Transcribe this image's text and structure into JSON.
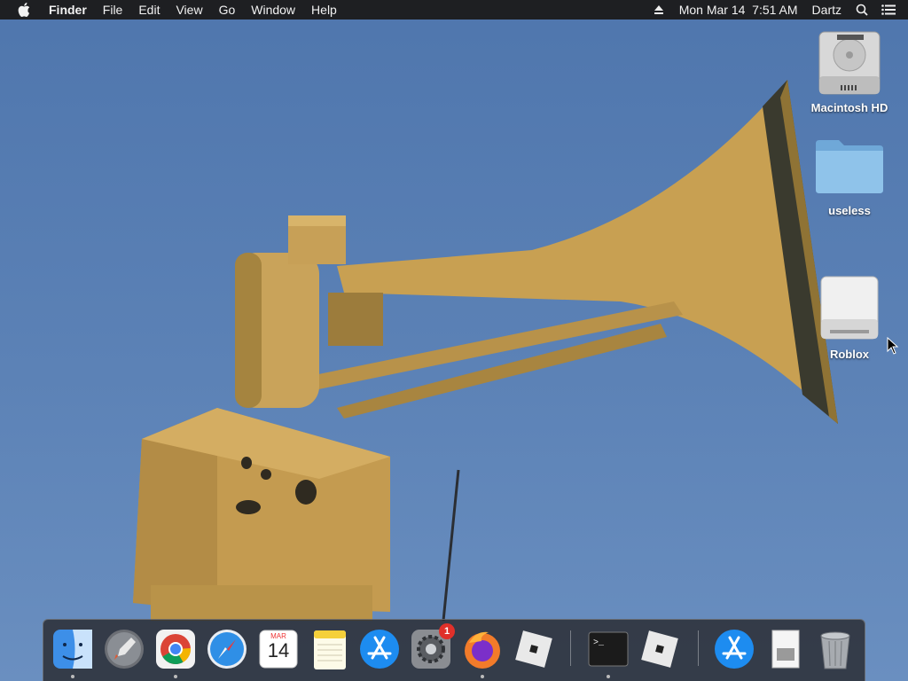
{
  "menubar": {
    "apple_icon": "apple-logo-icon",
    "app_name": "Finder",
    "menus": [
      "File",
      "Edit",
      "View",
      "Go",
      "Window",
      "Help"
    ],
    "clock": "Mon Mar 14  7:51 AM",
    "user": "Dartz",
    "status_icons": [
      "eject-icon",
      "spotlight-search-icon",
      "notification-center-icon"
    ]
  },
  "desktop": {
    "icons": [
      {
        "label": "Macintosh HD",
        "icon": "hard-drive-icon"
      },
      {
        "label": "useless",
        "icon": "folder-icon"
      },
      {
        "label": "Roblox",
        "icon": "external-drive-icon"
      }
    ]
  },
  "dock": {
    "apps": [
      {
        "name": "Finder",
        "icon": "finder-icon",
        "running": true
      },
      {
        "name": "Launchpad",
        "icon": "launchpad-icon",
        "running": false
      },
      {
        "name": "Google Chrome",
        "icon": "chrome-icon",
        "running": true
      },
      {
        "name": "Safari",
        "icon": "safari-icon",
        "running": false
      },
      {
        "name": "Calendar",
        "icon": "calendar-icon",
        "running": false,
        "month": "MAR",
        "day": "14"
      },
      {
        "name": "Notes",
        "icon": "notes-icon",
        "running": false
      },
      {
        "name": "App Store",
        "icon": "app-store-icon",
        "running": false
      },
      {
        "name": "System Preferences",
        "icon": "system-preferences-icon",
        "running": false,
        "badge": "1"
      },
      {
        "name": "Firefox",
        "icon": "firefox-icon",
        "running": true
      },
      {
        "name": "Roblox",
        "icon": "roblox-icon",
        "running": false
      },
      {
        "name": "Terminal",
        "icon": "terminal-icon",
        "running": true
      },
      {
        "name": "Roblox Studio",
        "icon": "roblox-studio-icon",
        "running": false
      },
      {
        "name": "Applications",
        "icon": "applications-folder-icon",
        "running": false
      },
      {
        "name": "Documents",
        "icon": "documents-stack-icon",
        "running": false
      },
      {
        "name": "Trash",
        "icon": "trash-icon",
        "running": false
      }
    ]
  },
  "colors": {
    "menubar_bg": "#1e1f22",
    "sky": "#5a7fb3",
    "siren": "#c9a35a",
    "dock_bg": "#2a2c30"
  }
}
